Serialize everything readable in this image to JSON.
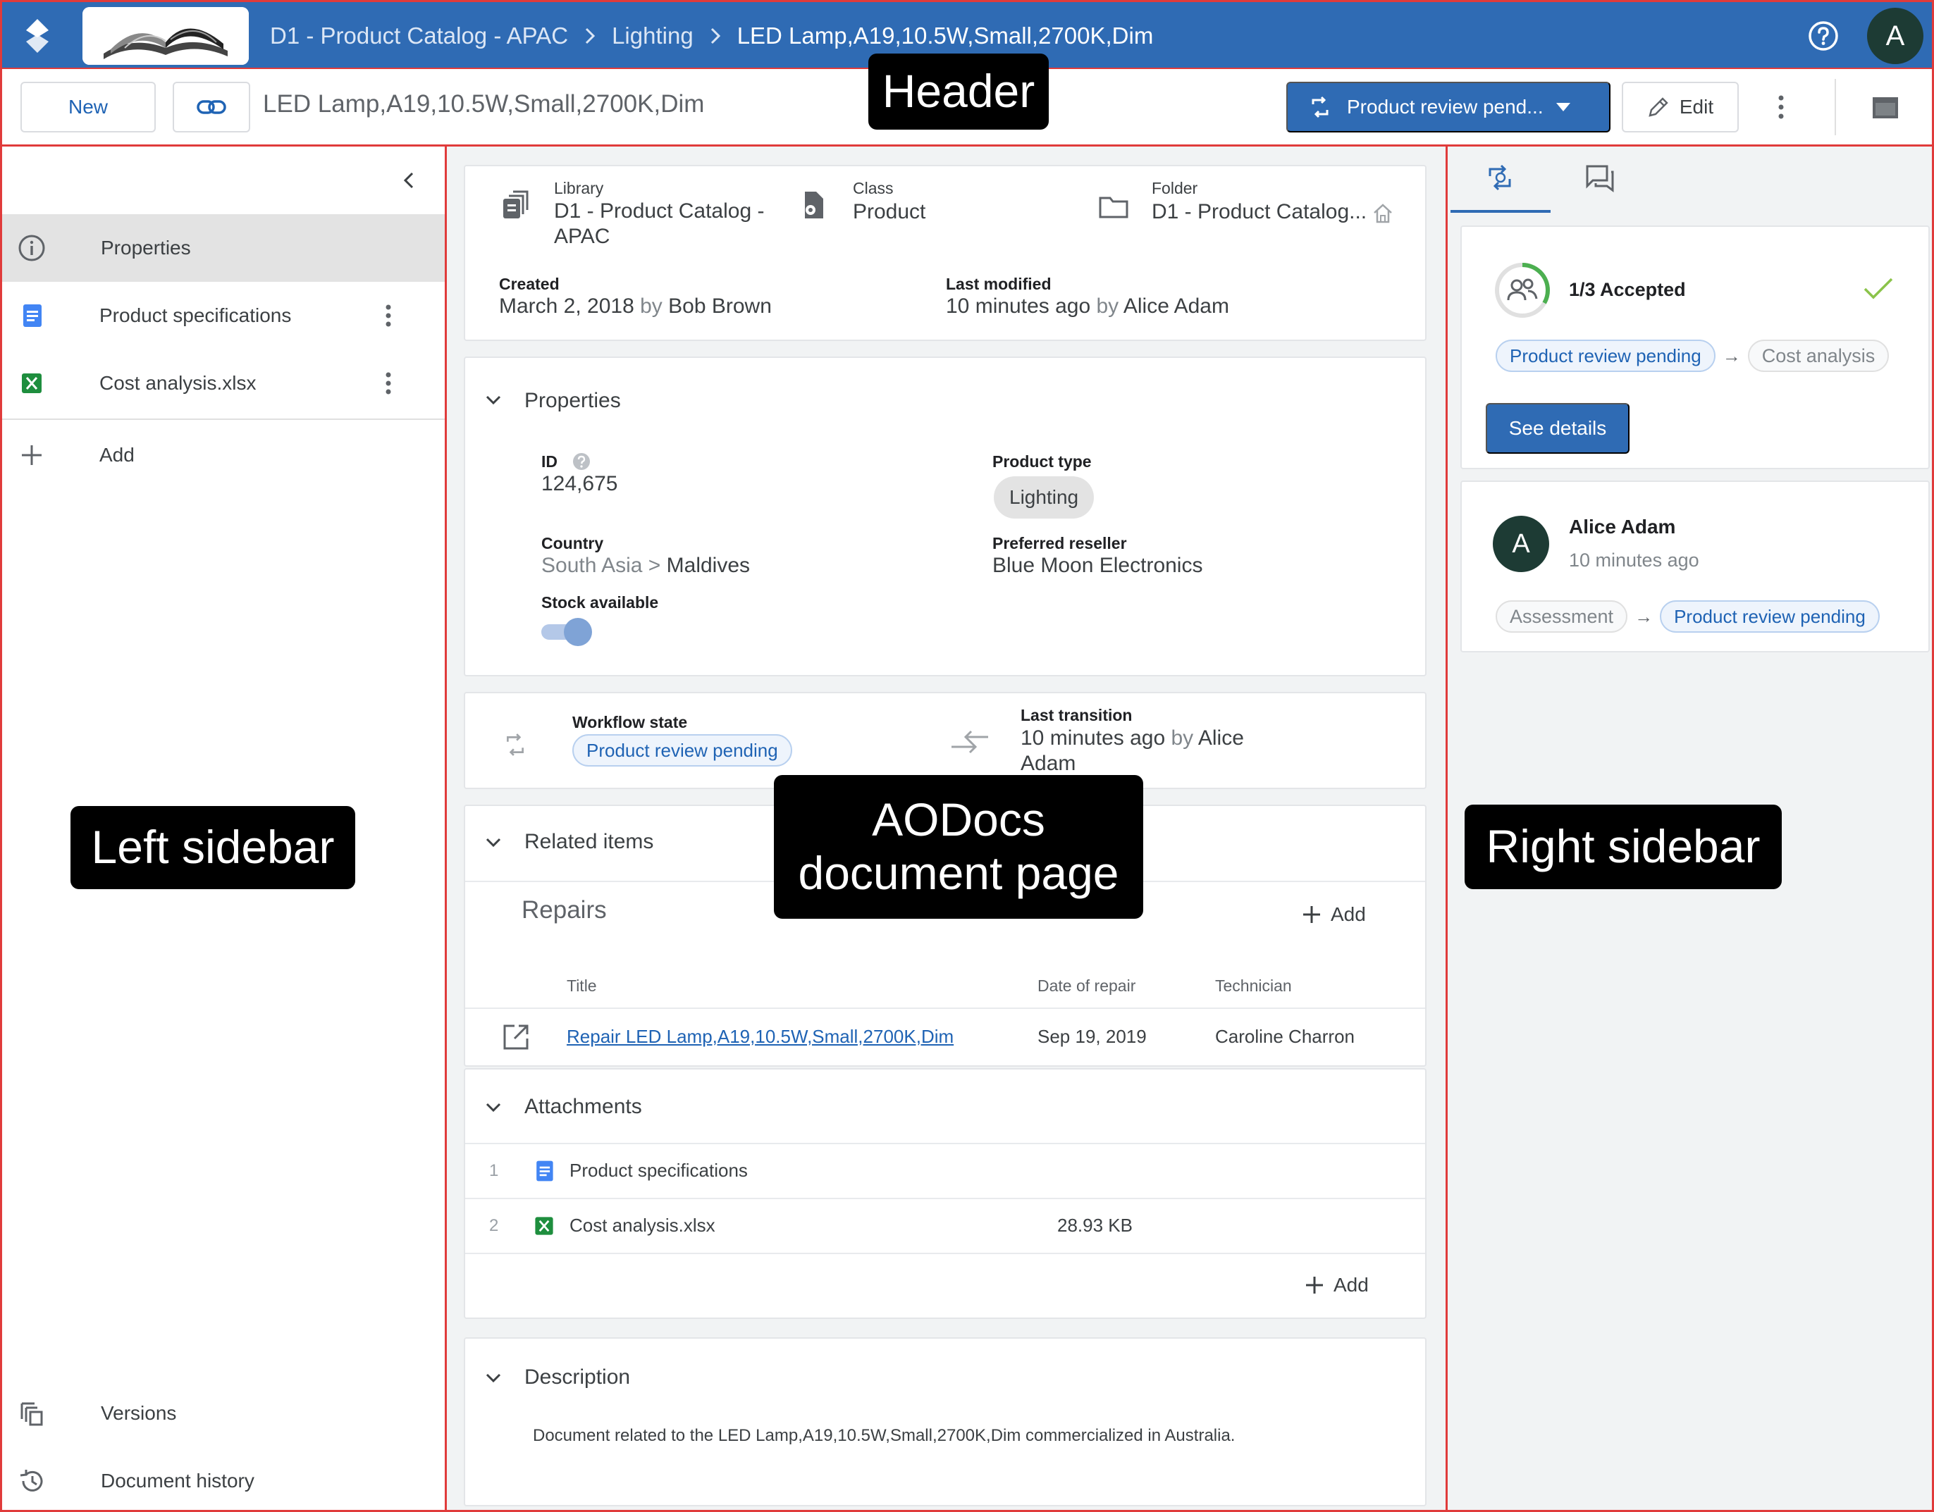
{
  "topbar": {
    "breadcrumbs": [
      "D1 - Product Catalog - APAC",
      "Lighting",
      "LED Lamp,A19,10.5W,Small,2700K,Dim"
    ],
    "avatar_initial": "A"
  },
  "actionbar": {
    "new_label": "New",
    "document_title": "LED Lamp,A19,10.5W,Small,2700K,Dim",
    "workflow_label": "Product review pend...",
    "edit_label": "Edit"
  },
  "sidebar": {
    "items": [
      {
        "label": "Properties",
        "icon": "info-icon"
      },
      {
        "label": "Product specifications",
        "icon": "google-doc-icon"
      },
      {
        "label": "Cost analysis.xlsx",
        "icon": "excel-icon"
      },
      {
        "label": "Add",
        "icon": "plus-icon"
      }
    ],
    "bottom_items": [
      {
        "label": "Versions",
        "icon": "versions-icon"
      },
      {
        "label": "Document history",
        "icon": "history-icon"
      }
    ]
  },
  "info": {
    "library_label": "Library",
    "library_value": "D1 - Product Catalog - APAC",
    "library_value_line1": "D1 - Product Catalog -",
    "library_value_line2": "APAC",
    "class_label": "Class",
    "class_value": "Product",
    "folder_label": "Folder",
    "folder_value": "D1 - Product Catalog...",
    "created_label": "Created",
    "created_date": "March 2, 2018",
    "created_by_word": "by",
    "created_by": "Bob Brown",
    "modified_label": "Last modified",
    "modified_date": "10 minutes ago",
    "modified_by_word": "by",
    "modified_by": "Alice Adam"
  },
  "properties": {
    "title": "Properties",
    "id_label": "ID",
    "id_value": "124,675",
    "product_type_label": "Product type",
    "product_type_value": "Lighting",
    "country_label": "Country",
    "country_region": "South Asia",
    "country_sep": ">",
    "country_value": "Maldives",
    "reseller_label": "Preferred reseller",
    "reseller_value": "Blue Moon Electronics",
    "stock_label": "Stock available",
    "stock_on": true
  },
  "workflow": {
    "state_label": "Workflow state",
    "state_value": "Product review pending",
    "transition_label": "Last transition",
    "transition_time": "10 minutes ago",
    "transition_by_word": "by",
    "transition_by_line1": "Alice",
    "transition_by_line2": "Adam"
  },
  "related": {
    "title": "Related items",
    "subtitle": "Repairs",
    "add_label": "Add",
    "columns": [
      "Title",
      "Date of repair",
      "Technician"
    ],
    "rows": [
      {
        "title": "Repair LED Lamp,A19,10.5W,Small,2700K,Dim",
        "date": "Sep 19, 2019",
        "technician": "Caroline Charron"
      }
    ]
  },
  "attachments": {
    "title": "Attachments",
    "add_label": "Add",
    "rows": [
      {
        "num": "1",
        "name": "Product specifications",
        "size": "",
        "icon": "google-doc-icon"
      },
      {
        "num": "2",
        "name": "Cost analysis.xlsx",
        "size": "28.93 KB",
        "icon": "excel-icon"
      }
    ]
  },
  "description": {
    "title": "Description",
    "text": "Document related to the LED Lamp,A19,10.5W,Small,2700K,Dim commercialized in Australia."
  },
  "right": {
    "approval": {
      "status": "1/3 Accepted",
      "progress_fraction": 0.333,
      "from_state": "Product review pending",
      "arrow": "→",
      "to_state": "Cost analysis",
      "button_label": "See details"
    },
    "history": {
      "avatar_initial": "A",
      "user": "Alice Adam",
      "time": "10 minutes ago",
      "from_state": "Assessment",
      "arrow": "→",
      "to_state": "Product review pending"
    }
  },
  "overlays": {
    "header": "Header",
    "left_sidebar": "Left sidebar",
    "document_page_line1": "AODocs",
    "document_page_line2": "document page",
    "right_sidebar": "Right sidebar"
  },
  "colors": {
    "brand_blue": "#2f6bb4",
    "annotation_red": "#e03b3b",
    "excel_green": "#1e8e3e",
    "doc_blue": "#4285f4"
  }
}
